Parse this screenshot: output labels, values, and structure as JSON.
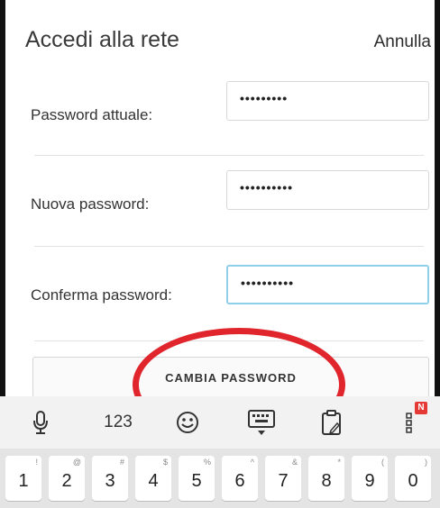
{
  "header": {
    "title": "Accedi alla rete",
    "cancel_label": "Annulla"
  },
  "form": {
    "rows": [
      {
        "label": "Password attuale:",
        "value": "•••••••••"
      },
      {
        "label": "Nuova password:",
        "value": "••••••••••"
      },
      {
        "label": "Conferma password:",
        "value": "••••••••••"
      }
    ],
    "submit_label": "CAMBIA PASSWORD"
  },
  "keyboard": {
    "toolbar": {
      "num_label": "123",
      "badge": "N"
    },
    "keys": [
      {
        "main": "1",
        "sub": "!"
      },
      {
        "main": "2",
        "sub": "@"
      },
      {
        "main": "3",
        "sub": "#"
      },
      {
        "main": "4",
        "sub": "$"
      },
      {
        "main": "5",
        "sub": "%"
      },
      {
        "main": "6",
        "sub": "^"
      },
      {
        "main": "7",
        "sub": "&"
      },
      {
        "main": "8",
        "sub": "*"
      },
      {
        "main": "9",
        "sub": "("
      },
      {
        "main": "0",
        "sub": ")"
      }
    ]
  },
  "colors": {
    "highlight": "#e0262c",
    "focus_border": "#8fd0e8",
    "badge": "#e53935"
  }
}
